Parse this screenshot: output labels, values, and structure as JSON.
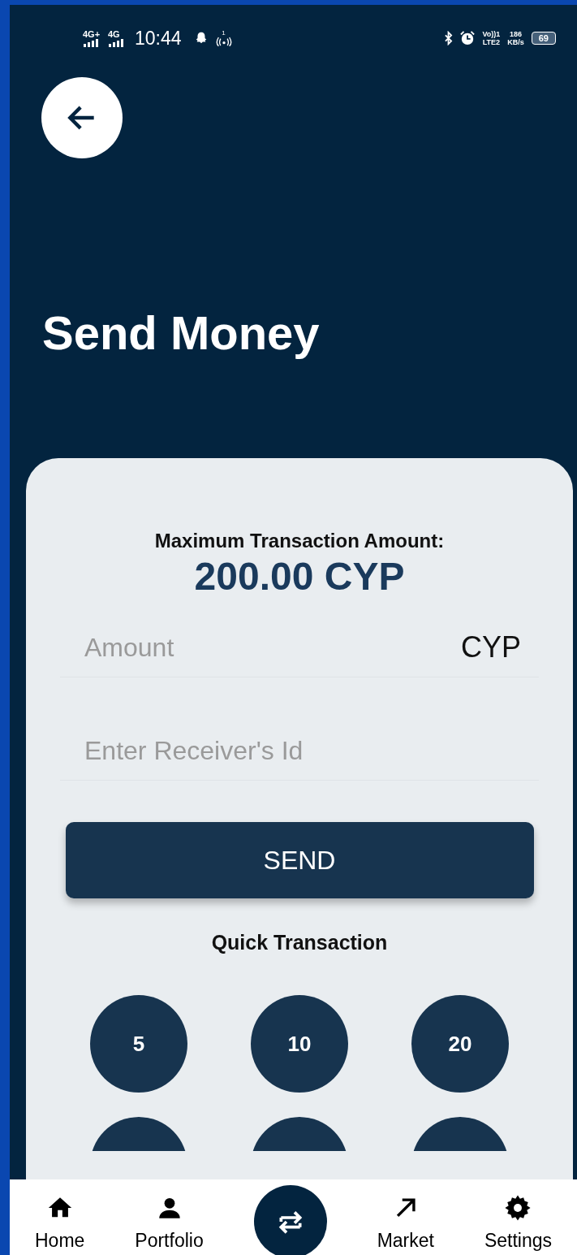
{
  "status_bar": {
    "left": [
      "4G+",
      "4G"
    ],
    "time": "10:44",
    "hotspot": "1",
    "volte": "Vo))1",
    "lte": "LTE2",
    "speed": "186",
    "speed_unit": "KB/s",
    "battery": "69"
  },
  "title": "Send Money",
  "limit": {
    "label": "Maximum Transaction Amount:",
    "value": "200.00 CYP"
  },
  "fields": [
    {
      "placeholder": "Amount",
      "suffix": "CYP"
    },
    {
      "placeholder": "Enter Receiver's Id"
    }
  ],
  "send_button": "SEND",
  "quick": {
    "title": "Quick Transaction",
    "buttons": [
      {
        "label": "5"
      },
      {
        "label": "10"
      },
      {
        "label": "20"
      },
      {
        "kind": "covered"
      },
      {
        "kind": "covered"
      },
      {
        "kind": "covered"
      }
    ]
  },
  "nav": [
    {
      "kind": "home",
      "label": "Home",
      "selected": false
    },
    {
      "kind": "person",
      "label": "Portfolio",
      "selected": false
    },
    {
      "kind": "transfer",
      "selected": true
    },
    {
      "kind": "arrow",
      "label": "Market",
      "selected": false
    },
    {
      "kind": "gear",
      "label": "Settings",
      "selected": false
    }
  ]
}
